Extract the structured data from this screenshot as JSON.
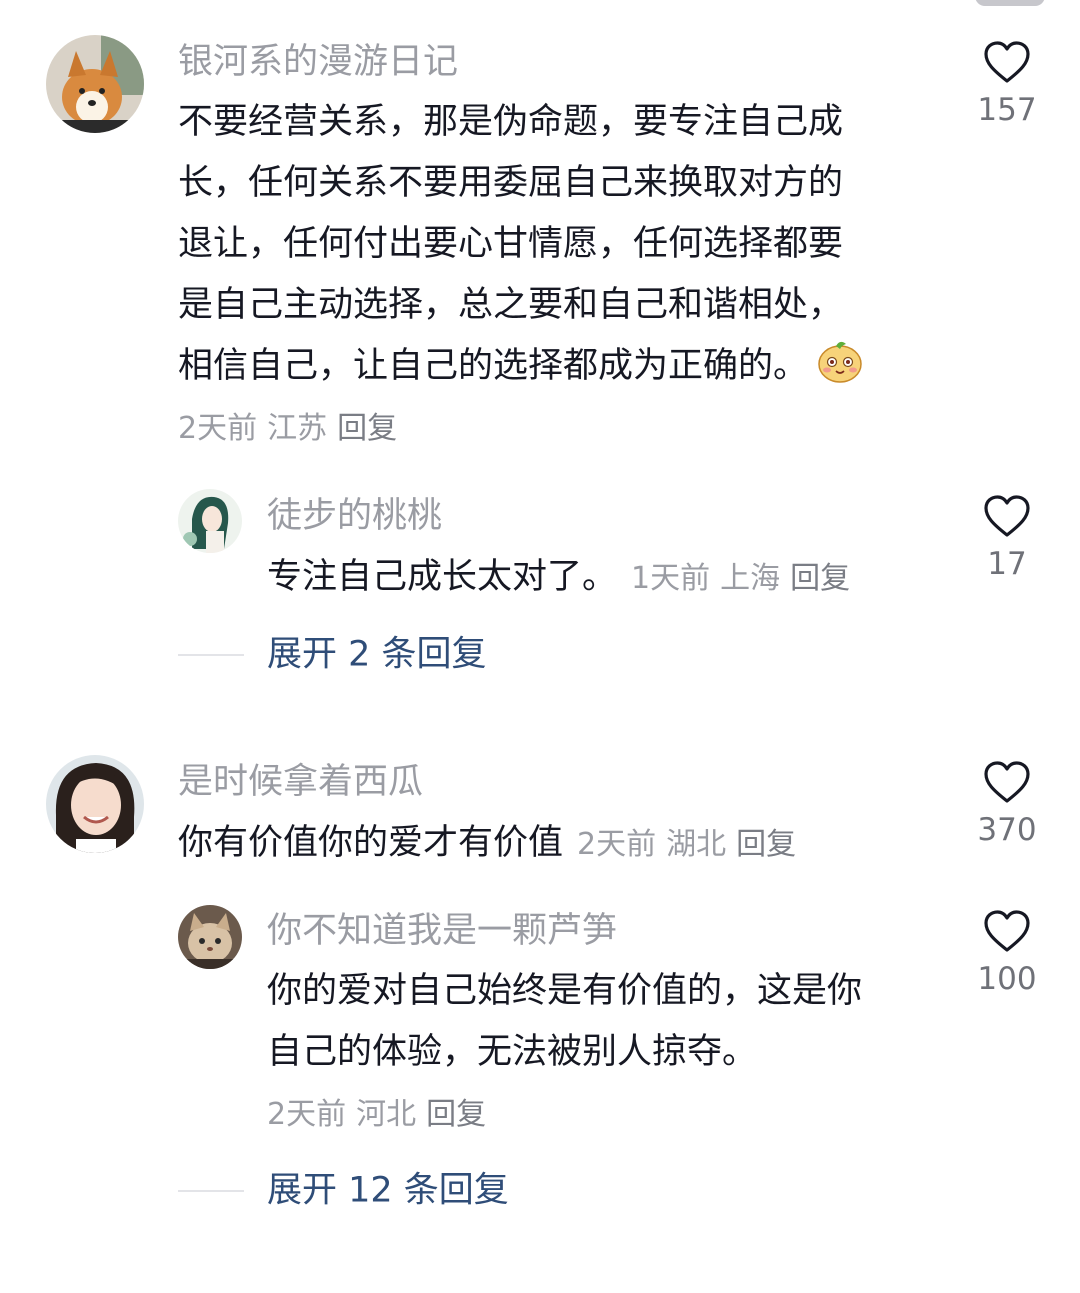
{
  "comments": [
    {
      "username": "银河系的漫游日记",
      "content_lines": [
        "不要经营关系，那是伪命题，要专注自己成",
        "长，任何关系不要用委屈自己来换取对方的",
        "退让，任何付出要心甘情愿，任何选择都要",
        "是自己主动选择，总之要和自己和谐相处，",
        "相信自己，让自己的选择都成为正确的。"
      ],
      "time": "2天前",
      "location": "江苏",
      "reply_label": "回复",
      "likes": "157",
      "replies": [
        {
          "username": "徒步的桃桃",
          "content": "专注自己成长太对了。",
          "time": "1天前",
          "location": "上海",
          "reply_label": "回复",
          "likes": "17"
        }
      ],
      "expand_label": "展开 2 条回复"
    },
    {
      "username": "是时候拿着西瓜",
      "content": "你有价值你的爱才有价值",
      "time": "2天前",
      "location": "湖北",
      "reply_label": "回复",
      "likes": "370",
      "replies": [
        {
          "username": "你不知道我是一颗芦笋",
          "content_lines": [
            "你的爱对自己始终是有价值的，这是你",
            "自己的体验，无法被别人掠夺。"
          ],
          "time": "2天前",
          "location": "河北",
          "reply_label": "回复",
          "likes": "100"
        }
      ],
      "expand_label": "展开 12 条回复"
    }
  ],
  "icons": {
    "like": "heart-outline-icon",
    "emoji": "smiling-mango-emoji"
  },
  "colors": {
    "text": "#161823",
    "meta": "#9a9ca3",
    "expand": "#2f4d78",
    "heart": "#161823"
  }
}
